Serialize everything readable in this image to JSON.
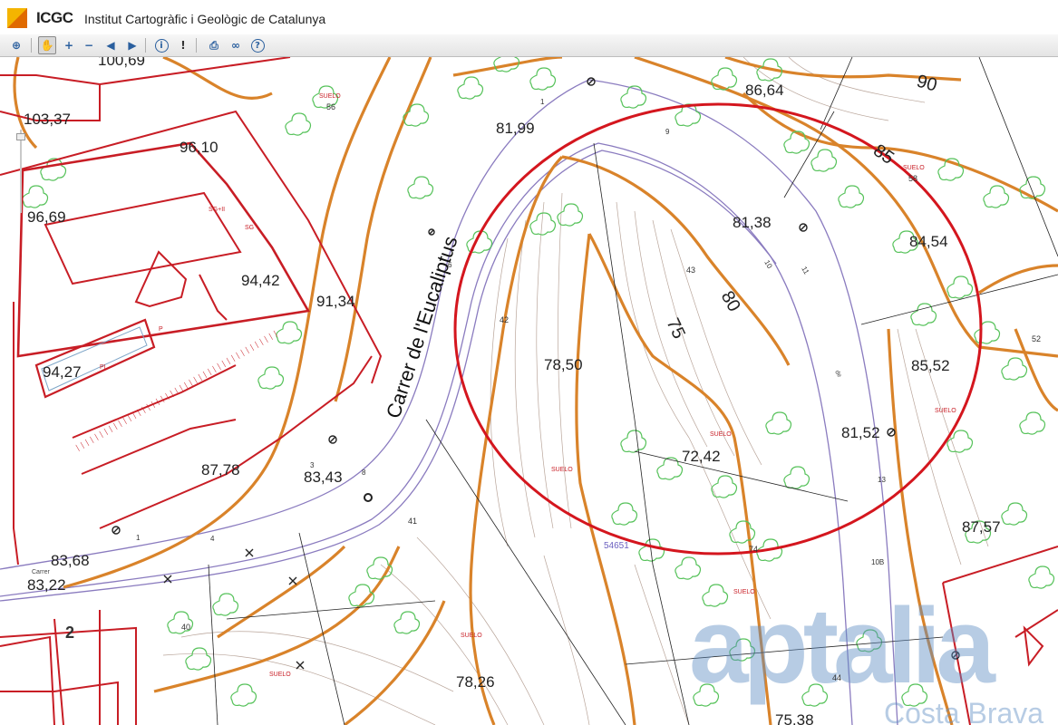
{
  "app": {
    "brand": "ICGC",
    "subtitle": "Institut Cartogràfic i Geològic de Catalunya"
  },
  "toolbar": {
    "tools": [
      {
        "name": "zoom-extent-icon",
        "glyph": "⊕"
      },
      {
        "name": "pan-hand-icon",
        "glyph": "✋",
        "active": true
      },
      {
        "name": "zoom-in-icon",
        "glyph": "+"
      },
      {
        "name": "zoom-out-icon",
        "glyph": "−"
      },
      {
        "name": "back-arrow-icon",
        "glyph": "◀"
      },
      {
        "name": "forward-arrow-icon",
        "glyph": "▶"
      },
      {
        "name": "info-icon",
        "glyph": "i"
      },
      {
        "name": "warning-icon",
        "glyph": "!"
      },
      {
        "name": "print-icon",
        "glyph": "⎙"
      },
      {
        "name": "link-icon",
        "glyph": "∞"
      },
      {
        "name": "help-icon",
        "glyph": "?"
      }
    ]
  },
  "map": {
    "street_name": "Carrer de l'Eucaliptus",
    "elevations": [
      {
        "id": "e1",
        "text": "100,69"
      },
      {
        "id": "e2",
        "text": "103,37"
      },
      {
        "id": "e3",
        "text": "96,10"
      },
      {
        "id": "e4",
        "text": "96,69"
      },
      {
        "id": "e5",
        "text": "94,42"
      },
      {
        "id": "e6",
        "text": "91,34"
      },
      {
        "id": "e7",
        "text": "94,27"
      },
      {
        "id": "e8",
        "text": "87,78"
      },
      {
        "id": "e9",
        "text": "83,43"
      },
      {
        "id": "e10",
        "text": "83,68"
      },
      {
        "id": "e11",
        "text": "83,22"
      },
      {
        "id": "e12",
        "text": "81,99"
      },
      {
        "id": "e13",
        "text": "86,64"
      },
      {
        "id": "e14",
        "text": "81,38"
      },
      {
        "id": "e15",
        "text": "84,54"
      },
      {
        "id": "e16",
        "text": "85,52"
      },
      {
        "id": "e17",
        "text": "81,52"
      },
      {
        "id": "e18",
        "text": "78,50"
      },
      {
        "id": "e19",
        "text": "72,42"
      },
      {
        "id": "e20",
        "text": "87,57"
      },
      {
        "id": "e21",
        "text": "78,26"
      },
      {
        "id": "e22",
        "text": "75,38"
      }
    ],
    "contour_labels": [
      {
        "id": "c90",
        "text": "90"
      },
      {
        "id": "c85",
        "text": "85"
      },
      {
        "id": "c80",
        "text": "80"
      },
      {
        "id": "c75",
        "text": "75"
      }
    ],
    "parcel_numbers": [
      {
        "id": "p56",
        "text": "56"
      },
      {
        "id": "p42",
        "text": "42"
      },
      {
        "id": "p43",
        "text": "43"
      },
      {
        "id": "p41",
        "text": "41"
      },
      {
        "id": "p40",
        "text": "40"
      },
      {
        "id": "p44",
        "text": "44"
      },
      {
        "id": "p52",
        "text": "52"
      },
      {
        "id": "p58",
        "text": "58"
      },
      {
        "id": "p74",
        "text": "74"
      },
      {
        "id": "p2",
        "text": "2"
      }
    ],
    "small_labels": [
      {
        "id": "s1",
        "text": "SUELO"
      },
      {
        "id": "s2",
        "text": "SUELO"
      },
      {
        "id": "s3",
        "text": "SUELO"
      },
      {
        "id": "s4",
        "text": "SUELO"
      },
      {
        "id": "s5",
        "text": "SUELO"
      },
      {
        "id": "s6",
        "text": "SUELO"
      },
      {
        "id": "s7",
        "text": "SUELO"
      },
      {
        "id": "s8",
        "text": "SUELO"
      },
      {
        "id": "s9",
        "text": "SG+II"
      },
      {
        "id": "s10",
        "text": "SG"
      },
      {
        "id": "s11",
        "text": "PI"
      },
      {
        "id": "s12",
        "text": "P"
      },
      {
        "id": "s13",
        "text": "Carrer"
      },
      {
        "id": "s14",
        "text": "de"
      },
      {
        "id": "s15",
        "text": "54651"
      }
    ],
    "address_numbers": [
      "1",
      "9",
      "10",
      "11",
      "13",
      "8",
      "4",
      "3",
      "6",
      "1",
      "10B"
    ],
    "watermark_line1": "aptalia",
    "watermark_line2": "Costa Brava"
  },
  "colors": {
    "contour": "#d9832a",
    "parcel": "#c81d25",
    "vegetation": "#56c25a",
    "road": "#8a7bbf",
    "circle": "#d4161e",
    "watermark": "#5f8fc4"
  }
}
